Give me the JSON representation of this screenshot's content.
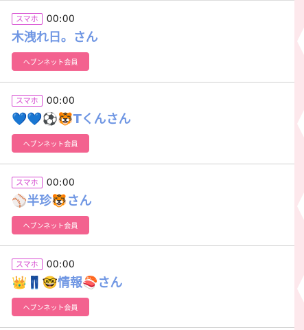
{
  "entries": [
    {
      "device": "スマホ",
      "time": "00:00",
      "name": "木洩れ日。さん",
      "button": "ヘブンネット会員"
    },
    {
      "device": "スマホ",
      "time": "00:00",
      "name": "💙💙⚽🐯Tくんさん",
      "button": "ヘブンネット会員"
    },
    {
      "device": "スマホ",
      "time": "00:00",
      "name": "⚾半珍🐯さん",
      "button": "ヘブンネット会員"
    },
    {
      "device": "スマホ",
      "time": "00:00",
      "name": "👑👖🤓情報🍣さん",
      "button": "ヘブンネット会員"
    }
  ],
  "colors": {
    "badge_border": "#d64bd1",
    "name_text": "#6f96e3",
    "button_bg": "#f3628f",
    "side_bg": "#fde8ec"
  }
}
